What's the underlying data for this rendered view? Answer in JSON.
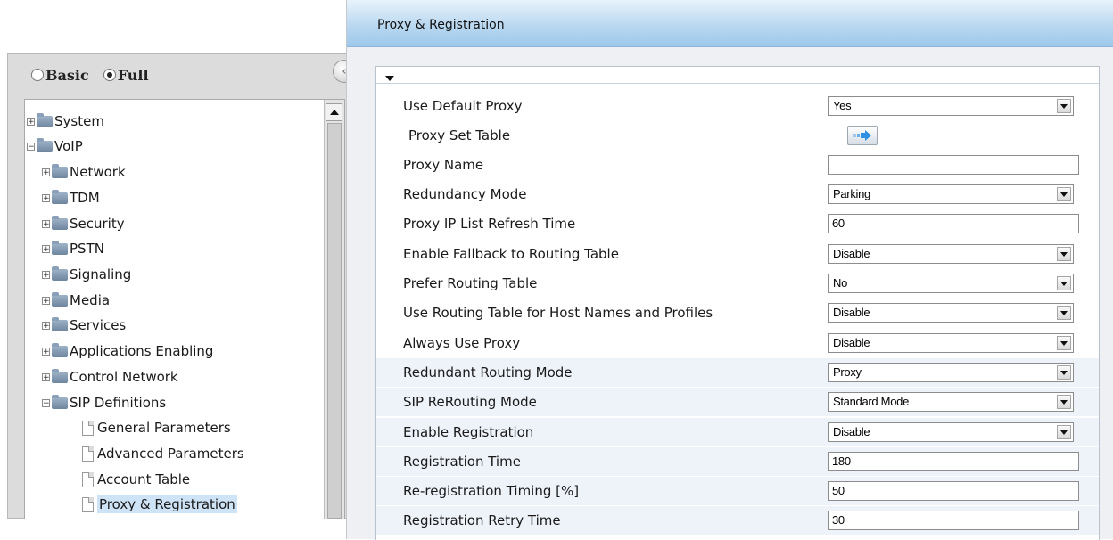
{
  "nav": {
    "mode_basic": "Basic",
    "mode_full": "Full",
    "selected_mode": "Full",
    "tree": {
      "system": "System",
      "voip": "VoIP",
      "network": "Network",
      "tdm": "TDM",
      "security": "Security",
      "pstn": "PSTN",
      "signaling": "Signaling",
      "media": "Media",
      "services": "Services",
      "applications_enabling": "Applications Enabling",
      "control_network": "Control Network",
      "sip_definitions": "SIP Definitions",
      "general_parameters": "General Parameters",
      "advanced_parameters": "Advanced Parameters",
      "account_table": "Account Table",
      "proxy_registration": "Proxy & Registration"
    },
    "selected_item": "Proxy & Registration",
    "expander_collapsed": "+",
    "expander_expanded": "−"
  },
  "page": {
    "title": "Proxy & Registration"
  },
  "params": {
    "use_default_proxy": {
      "label": "Use Default Proxy",
      "value": "Yes"
    },
    "proxy_set_table": {
      "label": "Proxy Set Table"
    },
    "proxy_name": {
      "label": "Proxy Name",
      "value": ""
    },
    "redundancy_mode": {
      "label": "Redundancy Mode",
      "value": "Parking"
    },
    "proxy_ip_list_refresh_time": {
      "label": "Proxy IP List Refresh Time",
      "value": "60"
    },
    "enable_fallback_to_routing_table": {
      "label": "Enable Fallback to Routing Table",
      "value": "Disable"
    },
    "prefer_routing_table": {
      "label": "Prefer Routing Table",
      "value": "No"
    },
    "use_routing_table_for_host_names": {
      "label": "Use Routing Table for Host Names and Profiles",
      "value": "Disable"
    },
    "always_use_proxy": {
      "label": "Always Use Proxy",
      "value": "Disable"
    },
    "redundant_routing_mode": {
      "label": "Redundant Routing Mode",
      "value": "Proxy"
    },
    "sip_rerouting_mode": {
      "label": "SIP ReRouting Mode",
      "value": "Standard Mode"
    },
    "enable_registration": {
      "label": "Enable Registration",
      "value": "Disable"
    },
    "registration_time": {
      "label": "Registration Time",
      "value": "180"
    },
    "reregistration_timing": {
      "label": "Re-registration Timing [%]",
      "value": "50"
    },
    "registration_retry_time": {
      "label": "Registration Retry Time",
      "value": "30"
    }
  },
  "icons": {
    "nav_collapse": "chevron-left-icon",
    "folder": "folder-icon",
    "page": "document-icon",
    "proxy_set_table_link": "arrow-right-icon",
    "section_toggle": "caret-down-icon"
  },
  "colors": {
    "header_gradient_start": "#e9f3fb",
    "header_gradient_end": "#9ec8ea",
    "selection": "#cfe3f6",
    "row_shade": "#eef3fa",
    "link_arrow": "#2f8fe0"
  }
}
